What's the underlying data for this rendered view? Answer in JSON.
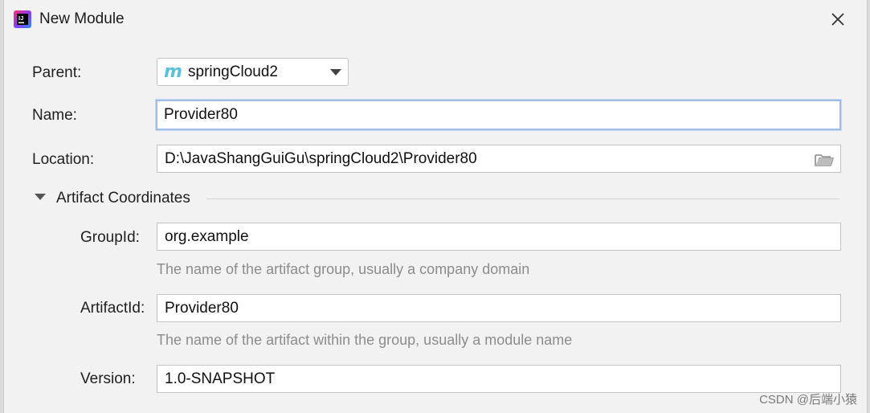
{
  "window": {
    "title": "New Module",
    "app_icon": "intellij-idea-icon",
    "close_icon": "close-icon"
  },
  "form": {
    "parent_label": "Parent:",
    "parent_value": "springCloud2",
    "parent_icon": "maven-module-icon",
    "name_label": "Name:",
    "name_value": "Provider80",
    "location_label": "Location:",
    "location_value": "D:\\JavaShangGuiGu\\springCloud2\\Provider80",
    "location_button_icon": "folder-icon"
  },
  "artifact": {
    "section_title": "Artifact Coordinates",
    "toggle_icon": "triangle-down-icon",
    "groupid_label": "GroupId:",
    "groupid_value": "org.example",
    "groupid_hint": "The name of the artifact group, usually a company domain",
    "artifactid_label": "ArtifactId:",
    "artifactid_value": "Provider80",
    "artifactid_hint": "The name of the artifact within the group, usually a module name",
    "version_label": "Version:",
    "version_value": "1.0-SNAPSHOT"
  },
  "watermark": "CSDN @后端小猿",
  "colors": {
    "accent": "#3574f0",
    "maven_m": "#5bc0de",
    "focus_border": "#9dbde8",
    "hint_text": "#8c8c8c"
  }
}
